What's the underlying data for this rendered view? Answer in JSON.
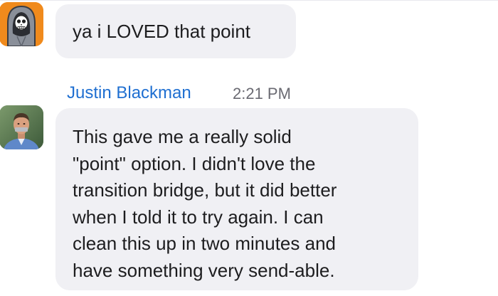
{
  "messages": [
    {
      "avatar": "grim-reaper-cartoon-avatar",
      "text": "ya i LOVED that point"
    },
    {
      "avatar": "photo-avatar",
      "sender": "Justin Blackman",
      "time": "2:21 PM",
      "text_lines": [
        "This gave me a really solid",
        "\"point\" option. I didn't love the",
        "transition bridge, but it did better",
        "when I told it to try again. I can",
        "clean this up in two minutes and",
        "have something very send-able."
      ]
    }
  ],
  "colors": {
    "bubble_bg": "#f0f0f4",
    "sender_name": "#1f6fd1",
    "timestamp": "#6a6a72",
    "avatar1_bg": "#f08a1c"
  }
}
